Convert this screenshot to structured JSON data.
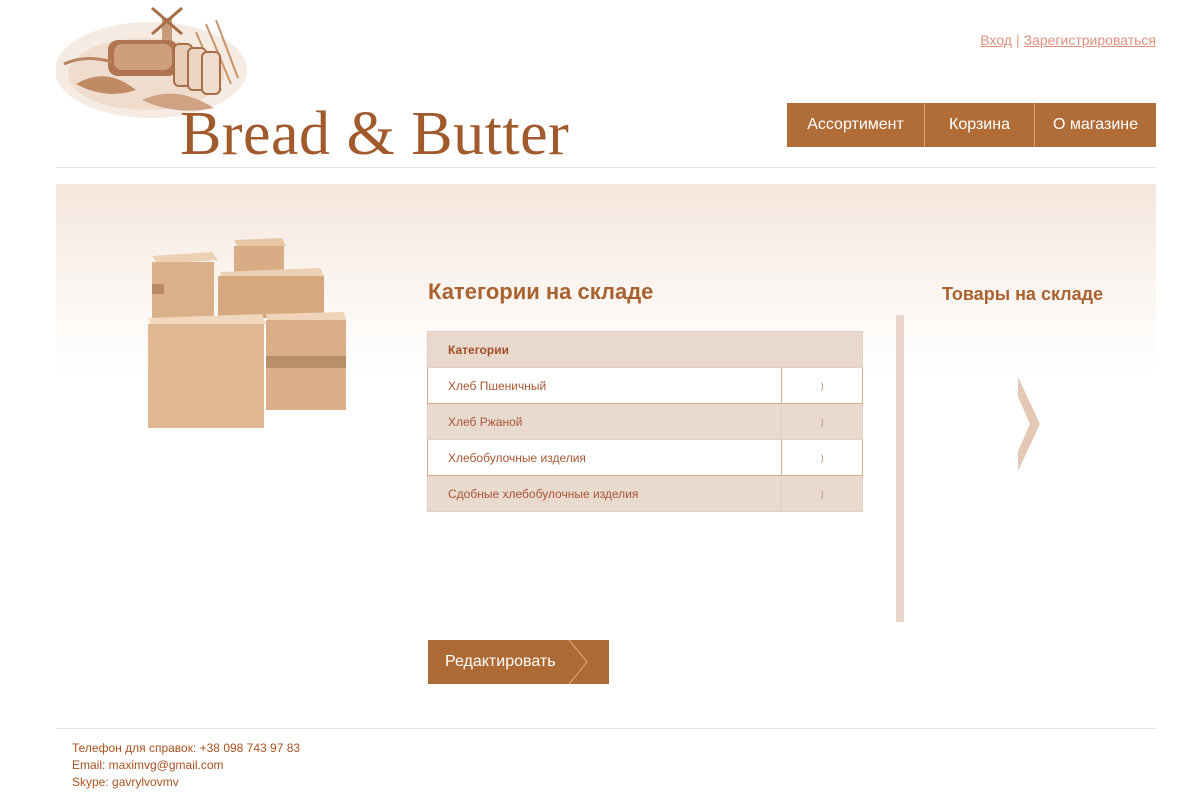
{
  "brand": {
    "name": "Bread & Butter"
  },
  "auth": {
    "login": "Вход",
    "separator": "|",
    "register": "Зарегистрироваться"
  },
  "nav": {
    "items": [
      "Ассортимент",
      "Корзина",
      "О магазине"
    ]
  },
  "categories": {
    "title": "Категории на складе",
    "header": "Категории",
    "rows": [
      {
        "name": "Хлеб Пшеничный",
        "arrow": ")"
      },
      {
        "name": "Хлеб Ржаной",
        "arrow": ")"
      },
      {
        "name": "Хлебобулочные изделия",
        "arrow": ")"
      },
      {
        "name": "Сдобные хлебобулочные изделия",
        "arrow": ")"
      }
    ]
  },
  "products": {
    "title": "Товары на складе",
    "next_icon": "chevron-right-icon"
  },
  "actions": {
    "edit_label": "Редактировать"
  },
  "footer": {
    "phone": "Телефон для справок: +38 098 743 97 83",
    "email": "Email: maximvg@gmail.com",
    "skype": "Skype: gavrylvovmv"
  },
  "colors": {
    "accent": "#b06d38",
    "text": "#a8622f",
    "row_alt": "#e9dad0",
    "header_row": "#e9d9cd",
    "link": "#e0907c"
  }
}
